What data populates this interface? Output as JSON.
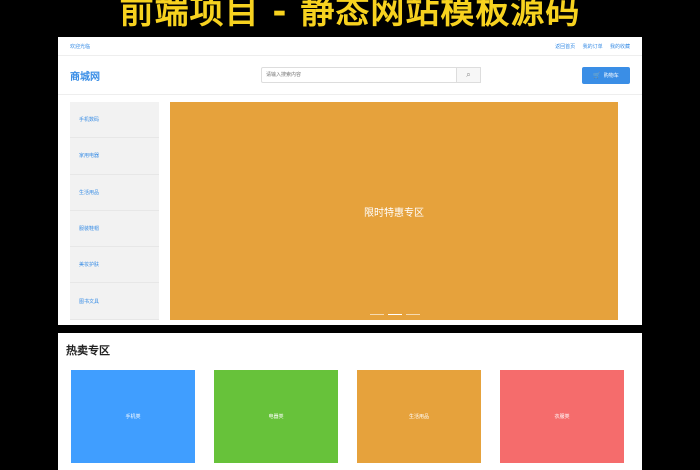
{
  "banner": {
    "text": "前端项目 - 静态网站模板源码"
  },
  "topbar": {
    "left": "欢迎光临",
    "links": [
      "返回首页",
      "我的订单",
      "我的收藏"
    ]
  },
  "header": {
    "logo": "商城网",
    "search_placeholder": "请输入搜索内容",
    "search_icon": "search-icon",
    "cart_label": "购物车",
    "cart_icon": "cart-icon"
  },
  "sidebar": {
    "items": [
      {
        "label": "手机数码"
      },
      {
        "label": "家用电器"
      },
      {
        "label": "生活用品"
      },
      {
        "label": "服装鞋帽"
      },
      {
        "label": "美妆护肤"
      },
      {
        "label": "图书文具"
      }
    ]
  },
  "hero": {
    "label": "限时特惠专区",
    "slides": 3,
    "active_slide": 1
  },
  "hot": {
    "title": "热卖专区",
    "cards": [
      {
        "label": "手机类",
        "color": "#409eff"
      },
      {
        "label": "电器类",
        "color": "#67c23a"
      },
      {
        "label": "生活用品",
        "color": "#e6a23c"
      },
      {
        "label": "衣服类",
        "color": "#f56c6c"
      }
    ]
  },
  "colors": {
    "accent": "#3a8ee6",
    "banner_text": "#f7d21f",
    "hero_bg": "#e6a23c"
  }
}
